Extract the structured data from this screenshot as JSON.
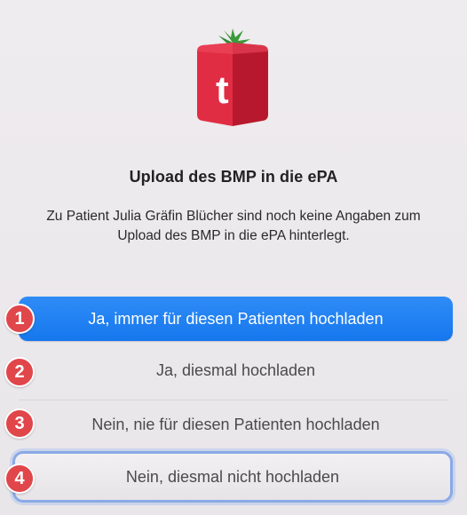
{
  "dialog": {
    "title": "Upload des BMP in die ePA",
    "message": "Zu Patient Julia Gräfin Blücher sind noch keine Angaben zum Upload des BMP in die ePA hinterlegt.",
    "app_icon": "tomedo-logo",
    "app_icon_letter": "t",
    "buttons": [
      {
        "label": "Ja, immer für diesen Patienten hochladen",
        "badge": "1",
        "style": "primary"
      },
      {
        "label": "Ja, diesmal hochladen",
        "badge": "2",
        "style": "plain"
      },
      {
        "label": "Nein, nie für diesen Patienten hochladen",
        "badge": "3",
        "style": "plain"
      },
      {
        "label": "Nein, diesmal nicht hochladen",
        "badge": "4",
        "style": "focused"
      }
    ]
  },
  "colors": {
    "primary": "#1f80f2",
    "badge": "#e0464a",
    "logo_red": "#d6243a",
    "logo_green": "#3a9a3a"
  }
}
